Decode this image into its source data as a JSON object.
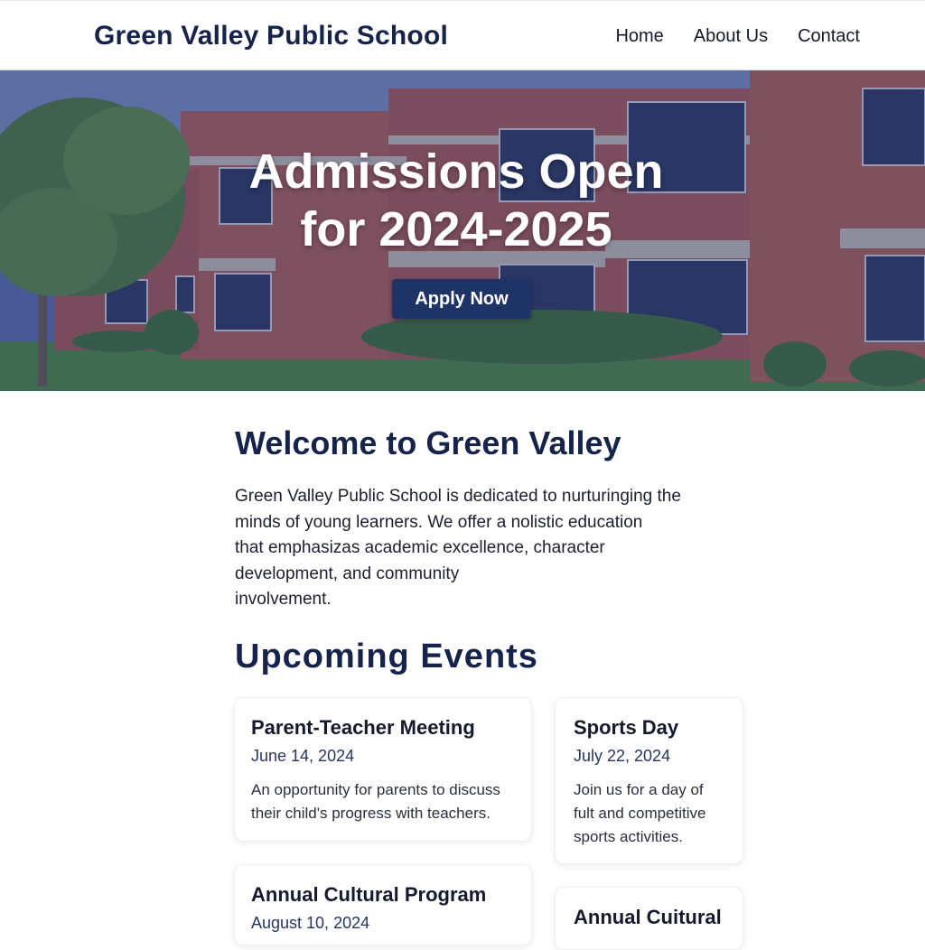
{
  "header": {
    "title": "Green Valley Public School",
    "nav": [
      "Home",
      "About Us",
      "Contact"
    ]
  },
  "hero": {
    "title_line1": "Admissions Open",
    "title_line2": "for 2024-2025",
    "cta_label": "Apply Now"
  },
  "welcome": {
    "title": "Welcome to Green Valley",
    "paragraph_lines": [
      "Green Valley Public School is dedicated to nurturinging the",
      "minds of young learners. We offer a nolistic education",
      "that emphasizas academic excellence, character",
      "development, and community",
      "involvement."
    ]
  },
  "events": {
    "title": "Upcoming Events",
    "items": [
      {
        "title": "Parent-Teacher Meeting",
        "date": "June 14, 2024",
        "description": "An opportunity for parents to discuss their child's progress with teachers."
      },
      {
        "title": "Sports Day",
        "date": "July  22, 2024",
        "description": "Join us for a day of fult and competitive sports activities."
      },
      {
        "title": "Annual Cultural Program",
        "date": "August 10, 2024",
        "description": ""
      },
      {
        "title": "Annual Cuitural",
        "date": "",
        "description": ""
      }
    ]
  },
  "colors": {
    "brand": "#16234a",
    "button": "#1f3466",
    "hero_overlay": "#2a3a78"
  }
}
